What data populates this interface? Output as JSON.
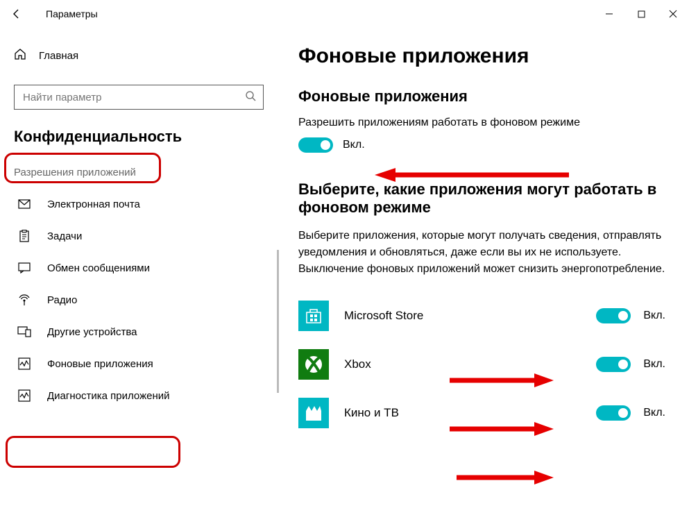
{
  "titlebar": {
    "title": "Параметры"
  },
  "sidebar": {
    "home": "Главная",
    "search_placeholder": "Найти параметр",
    "category": "Конфиденциальность",
    "section": "Разрешения приложений",
    "items": [
      {
        "label": "Электронная почта"
      },
      {
        "label": "Задачи"
      },
      {
        "label": "Обмен сообщениями"
      },
      {
        "label": "Радио"
      },
      {
        "label": "Другие устройства"
      },
      {
        "label": "Фоновые приложения"
      },
      {
        "label": "Диагностика приложений"
      }
    ]
  },
  "content": {
    "h1": "Фоновые приложения",
    "h2a": "Фоновые приложения",
    "permission_label": "Разрешить приложениям работать в фоновом режиме",
    "master_toggle_state": "Вкл.",
    "h2b": "Выберите, какие приложения могут работать в фоновом режиме",
    "desc": "Выберите приложения, которые могут получать сведения, отправлять уведомления и обновляться, даже если вы их не используете. Выключение фоновых приложений может снизить энергопотребление.",
    "apps": [
      {
        "name": "Microsoft Store",
        "state": "Вкл."
      },
      {
        "name": "Xbox",
        "state": "Вкл."
      },
      {
        "name": "Кино и ТВ",
        "state": "Вкл."
      }
    ]
  },
  "colors": {
    "accent": "#00b7c3",
    "xbox": "#107c10"
  }
}
